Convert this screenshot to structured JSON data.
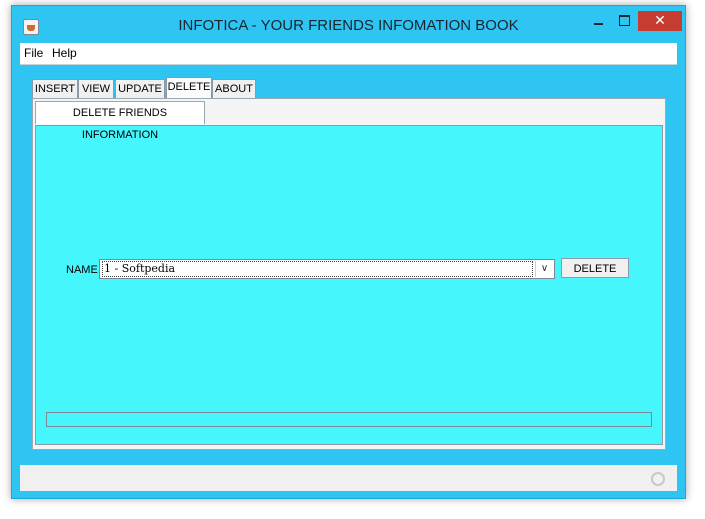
{
  "window": {
    "title": "INFOTICA - YOUR FRIENDS INFOMATION BOOK",
    "controls": {
      "minimize": "",
      "maximize": "",
      "close": "✕"
    },
    "app_icon": "java-cup-icon"
  },
  "menu": {
    "file": "File",
    "help": "Help"
  },
  "tabs": {
    "insert": "INSERT",
    "view": "VIEW",
    "update": "UPDATE",
    "delete": "DELETE",
    "about": "ABOUT",
    "selected": "DELETE"
  },
  "delete_panel": {
    "tab_label": "DELETE FRIENDS INFORMATION",
    "name_label": "NAME",
    "selected_name": "1 - Softpedia",
    "dropdown_icon": "chevron-down-icon",
    "delete_button": "DELETE",
    "status_text": ""
  },
  "colors": {
    "window_frame": "#2ec5f2",
    "panel_background": "#46f6fd",
    "close_button": "#c73c31"
  }
}
